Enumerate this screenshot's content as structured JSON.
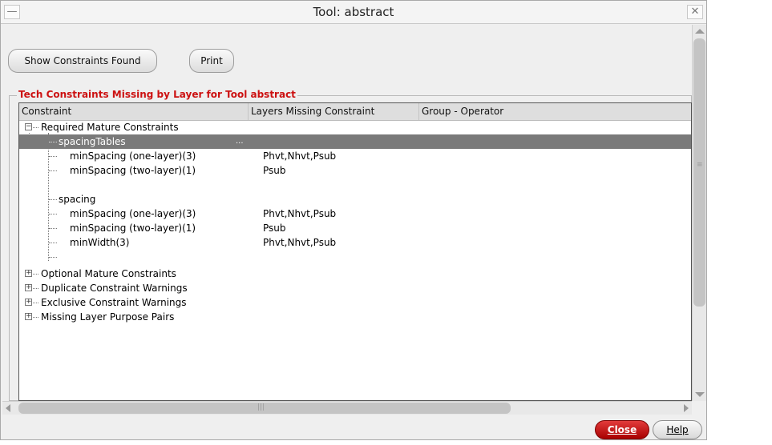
{
  "window": {
    "title": "Tool:  abstract",
    "minimize_glyph": "—",
    "close_glyph": "✕"
  },
  "toolbar": {
    "show_constraints_label": "Show Constraints Found",
    "print_label": "Print"
  },
  "group": {
    "title": "Tech Constraints Missing by Layer for Tool abstract"
  },
  "table": {
    "headers": [
      "Constraint",
      "Layers Missing Constraint",
      "Group - Operator"
    ],
    "rows": [
      {
        "label": "Required Mature Constraints",
        "layers": "",
        "expander": "−"
      },
      {
        "label": "spacingTables",
        "layers": "...",
        "selected": true
      },
      {
        "label": "minSpacing (one-layer)(3)",
        "layers": "Phvt,Nhvt,Psub"
      },
      {
        "label": "minSpacing (two-layer)(1)",
        "layers": "Psub"
      },
      {
        "label": "",
        "layers": ""
      },
      {
        "label": "spacing",
        "layers": ""
      },
      {
        "label": "minSpacing (one-layer)(3)",
        "layers": "Phvt,Nhvt,Psub"
      },
      {
        "label": "minSpacing (two-layer)(1)",
        "layers": "Psub"
      },
      {
        "label": "minWidth(3)",
        "layers": "Phvt,Nhvt,Psub"
      },
      {
        "label": "",
        "layers": ""
      },
      {
        "label": "Optional Mature Constraints",
        "layers": "",
        "expander": "+"
      },
      {
        "label": "Duplicate Constraint Warnings",
        "layers": "",
        "expander": "+"
      },
      {
        "label": "Exclusive Constraint Warnings",
        "layers": "",
        "expander": "+"
      },
      {
        "label": "Missing Layer Purpose Pairs",
        "layers": "",
        "expander": "+"
      }
    ]
  },
  "footer": {
    "close_label": "Close",
    "help_label": "Help"
  },
  "colors": {
    "group_title": "#cc1111",
    "selected_row": "#7a7a7a",
    "close_button": "#c00000"
  }
}
